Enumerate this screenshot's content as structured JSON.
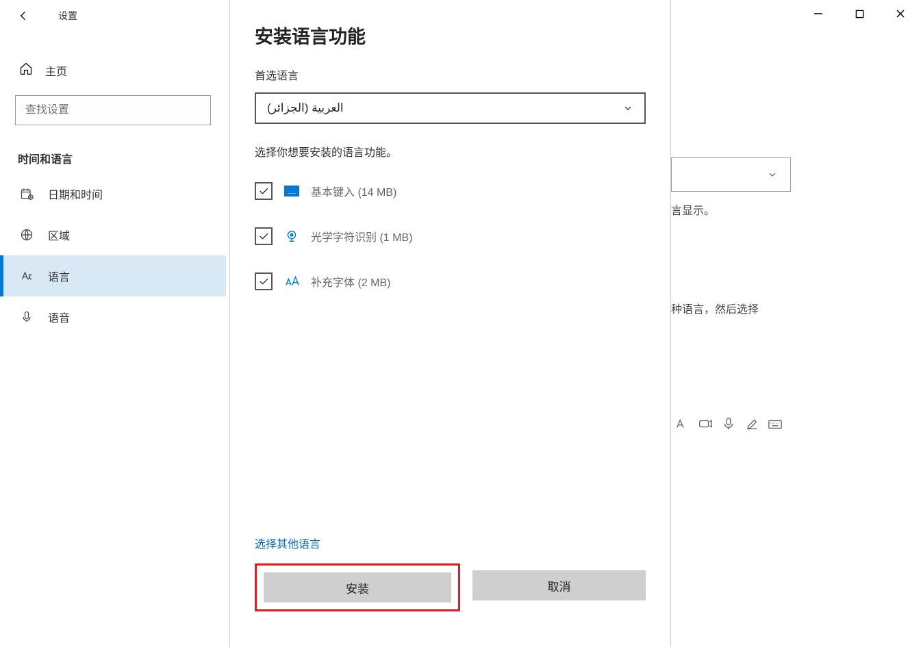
{
  "window": {
    "title": "设置",
    "controls": {
      "min": "min",
      "max": "max",
      "close": "close"
    }
  },
  "sidebar": {
    "home": "主页",
    "search_placeholder": "查找设置",
    "category": "时间和语言",
    "items": [
      {
        "label": "日期和时间",
        "icon": "calendar-clock"
      },
      {
        "label": "区域",
        "icon": "globe"
      },
      {
        "label": "语言",
        "icon": "language",
        "selected": true
      },
      {
        "label": "语音",
        "icon": "microphone"
      }
    ]
  },
  "background_peek": {
    "dropdown_visible_hint": "chevron",
    "text1": "言显示。",
    "text2": "种语言，然后选择"
  },
  "dialog": {
    "title": "安装语言功能",
    "preferred_label": "首选语言",
    "selected_language": "العربية (الجزائر)",
    "instruction": "选择你想要安装的语言功能。",
    "options": [
      {
        "icon": "keyboard",
        "label": "基本键入 (14 MB)",
        "checked": true
      },
      {
        "icon": "ocr",
        "label": "光学字符识别 (1 MB)",
        "checked": true
      },
      {
        "icon": "font",
        "label": "补充字体 (2 MB)",
        "checked": true
      }
    ],
    "alt_link": "选择其他语言",
    "buttons": {
      "install": "安装",
      "cancel": "取消"
    }
  }
}
